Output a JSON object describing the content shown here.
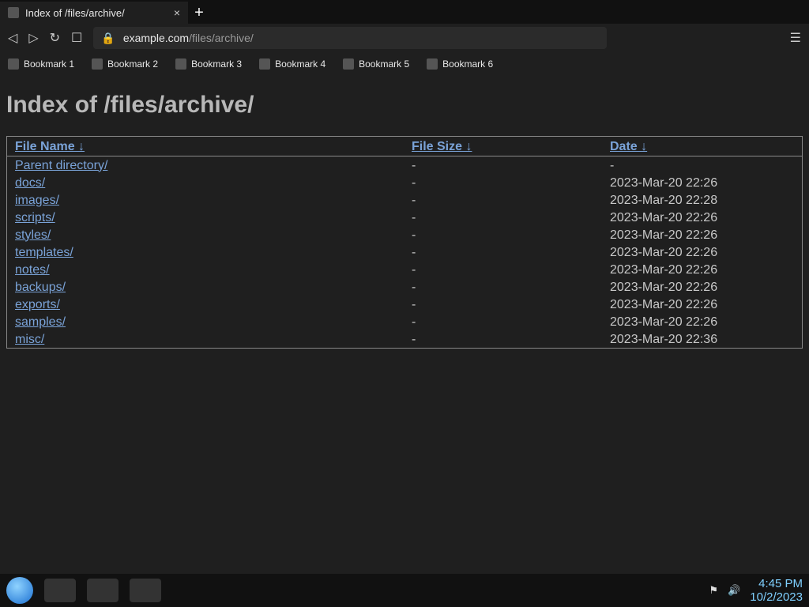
{
  "tab": {
    "title": "Index of /files/archive/",
    "close_icon": "×",
    "new_tab_icon": "+"
  },
  "omnibox": {
    "host": "example.com",
    "path": "/files/archive/"
  },
  "bookmarks": [
    "Bookmark 1",
    "Bookmark 2",
    "Bookmark 3",
    "Bookmark 4",
    "Bookmark 5",
    "Bookmark 6"
  ],
  "page": {
    "heading": "Index of /files/archive/",
    "columns": [
      "File Name ↓",
      "File Size ↓",
      "Date ↓"
    ],
    "rows": [
      {
        "name": "Parent directory/",
        "size": "-",
        "date": "-"
      },
      {
        "name": "docs/",
        "size": "-",
        "date": "2023-Mar-20 22:26"
      },
      {
        "name": "images/",
        "size": "-",
        "date": "2023-Mar-20 22:28"
      },
      {
        "name": "scripts/",
        "size": "-",
        "date": "2023-Mar-20 22:26"
      },
      {
        "name": "styles/",
        "size": "-",
        "date": "2023-Mar-20 22:26"
      },
      {
        "name": "templates/",
        "size": "-",
        "date": "2023-Mar-20 22:26"
      },
      {
        "name": "notes/",
        "size": "-",
        "date": "2023-Mar-20 22:26"
      },
      {
        "name": "backups/",
        "size": "-",
        "date": "2023-Mar-20 22:26"
      },
      {
        "name": "exports/",
        "size": "-",
        "date": "2023-Mar-20 22:26"
      },
      {
        "name": "samples/",
        "size": "-",
        "date": "2023-Mar-20 22:26"
      },
      {
        "name": "misc/",
        "size": "-",
        "date": "2023-Mar-20 22:36"
      }
    ]
  },
  "taskbar": {
    "time": "4:45 PM",
    "date": "10/2/2023"
  }
}
